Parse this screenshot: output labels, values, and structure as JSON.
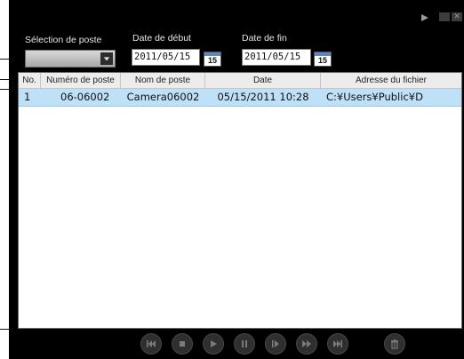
{
  "window": {
    "controls": {
      "play_icon": "play-icon",
      "minimize_icon": "minimize-icon",
      "close_icon": "close-icon"
    }
  },
  "filters": {
    "station_label": "Sélection de poste",
    "station_value": "",
    "start_label": "Date de début",
    "start_value": "2011/05/15",
    "end_label": "Date de fin",
    "end_value": "2011/05/15",
    "calendar_day": "15"
  },
  "table": {
    "columns": [
      "No.",
      "Numéro de poste",
      "Nom de poste",
      "Date",
      "Adresse du fichier"
    ],
    "rows": [
      [
        "1",
        "06-06002",
        "Camera06002",
        "05/15/2011 10:28",
        "C:¥Users¥Public¥D"
      ]
    ]
  },
  "playback": {
    "buttons": [
      "skip-back-icon",
      "stop-icon",
      "play-icon",
      "pause-icon",
      "step-forward-icon",
      "fast-forward-icon",
      "skip-forward-icon",
      "delete-icon"
    ]
  },
  "colors": {
    "background": "#000000",
    "selected_row": "#bfe1f7",
    "calendar_accent": "#5b87c6"
  }
}
